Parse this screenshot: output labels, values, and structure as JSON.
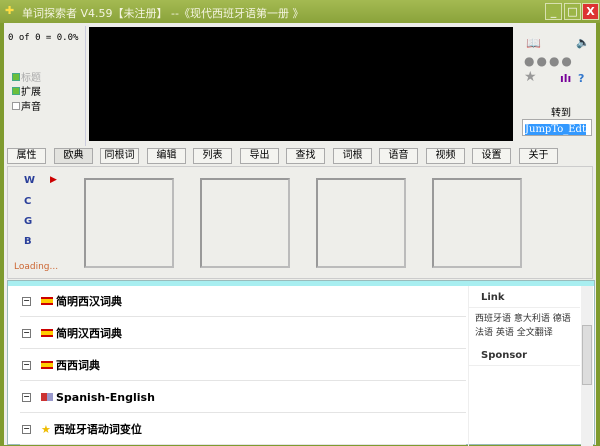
{
  "window": {
    "title": "单词探索者 V4.59【未注册】 --《现代西班牙语第一册 》",
    "minimize": "_",
    "maximize": "□",
    "close": "X"
  },
  "left": {
    "progress": "0 of 0 = 0.0%",
    "options": [
      {
        "label": "标题",
        "checked": true,
        "disabled": true
      },
      {
        "label": "扩展",
        "checked": true
      },
      {
        "label": "声音",
        "checked": false
      }
    ]
  },
  "right": {
    "goto_label": "转到",
    "jump_value": "JumpTo_Edt"
  },
  "toolbar": [
    "属性",
    "欧典",
    "同根词",
    "编辑",
    "列表",
    "导出",
    "查找",
    "词根",
    "语音",
    "视频",
    "设置",
    "关于"
  ],
  "mid": {
    "letters": [
      "W",
      "C",
      "G",
      "B"
    ],
    "loading": "Loading..."
  },
  "browser": {
    "rows": [
      "简明西汉词典",
      "简明汉西词典",
      "西西词典",
      "Spanish-English",
      "西班牙语动词变位"
    ],
    "link_title": "Link",
    "links": [
      "西班牙语",
      "意大利语",
      "德语",
      "法语",
      "英语",
      "全文翻译"
    ],
    "sponsor_title": "Sponsor"
  }
}
